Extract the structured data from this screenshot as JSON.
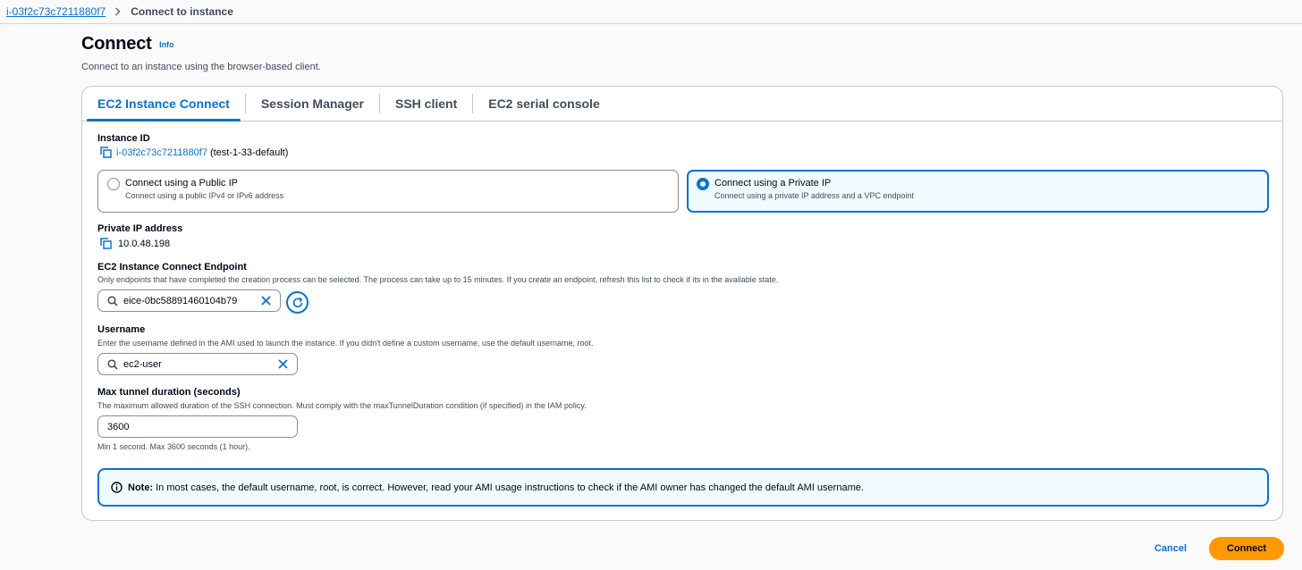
{
  "breadcrumb": {
    "instance_link": "i-03f2c73c7211880f7",
    "current": "Connect to instance"
  },
  "header": {
    "title": "Connect",
    "info": "Info",
    "description": "Connect to an instance using the browser-based client."
  },
  "tabs": [
    {
      "label": "EC2 Instance Connect",
      "active": true
    },
    {
      "label": "Session Manager",
      "active": false
    },
    {
      "label": "SSH client",
      "active": false
    },
    {
      "label": "EC2 serial console",
      "active": false
    }
  ],
  "instance": {
    "label": "Instance ID",
    "id": "i-03f2c73c7211880f7",
    "name_suffix": "(test-1-33-default)"
  },
  "connection_type": {
    "public": {
      "title": "Connect using a Public IP",
      "desc": "Connect using a public IPv4 or IPv6 address",
      "selected": false
    },
    "private": {
      "title": "Connect using a Private IP",
      "desc": "Connect using a private IP address and a VPC endpoint",
      "selected": true
    }
  },
  "private_ip": {
    "label": "Private IP address",
    "value": "10.0.48.198"
  },
  "endpoint": {
    "label": "EC2 Instance Connect Endpoint",
    "help": "Only endpoints that have completed the creation process can be selected. The process can take up to 15 minutes. If you create an endpoint, refresh this list to check if its in the available state.",
    "value": "eice-0bc58891460104b79"
  },
  "username": {
    "label": "Username",
    "help": "Enter the username defined in the AMI used to launch the instance. If you didn't define a custom username, use the default username, root.",
    "value": "ec2-user"
  },
  "tunnel": {
    "label": "Max tunnel duration (seconds)",
    "help": "The maximum allowed duration of the SSH connection. Must comply with the maxTunnelDuration condition (if specified) in the IAM policy.",
    "value": "3600",
    "constraint": "Min 1 second. Max 3600 seconds (1 hour)."
  },
  "note": {
    "prefix": "Note:",
    "text": "In most cases, the default username, root, is correct. However, read your AMI usage instructions to check if the AMI owner has changed the default AMI username."
  },
  "actions": {
    "cancel": "Cancel",
    "connect": "Connect"
  },
  "colors": {
    "accent": "#0972d3",
    "primary_button": "#ff9900",
    "selected_bg": "#f0fbff"
  }
}
